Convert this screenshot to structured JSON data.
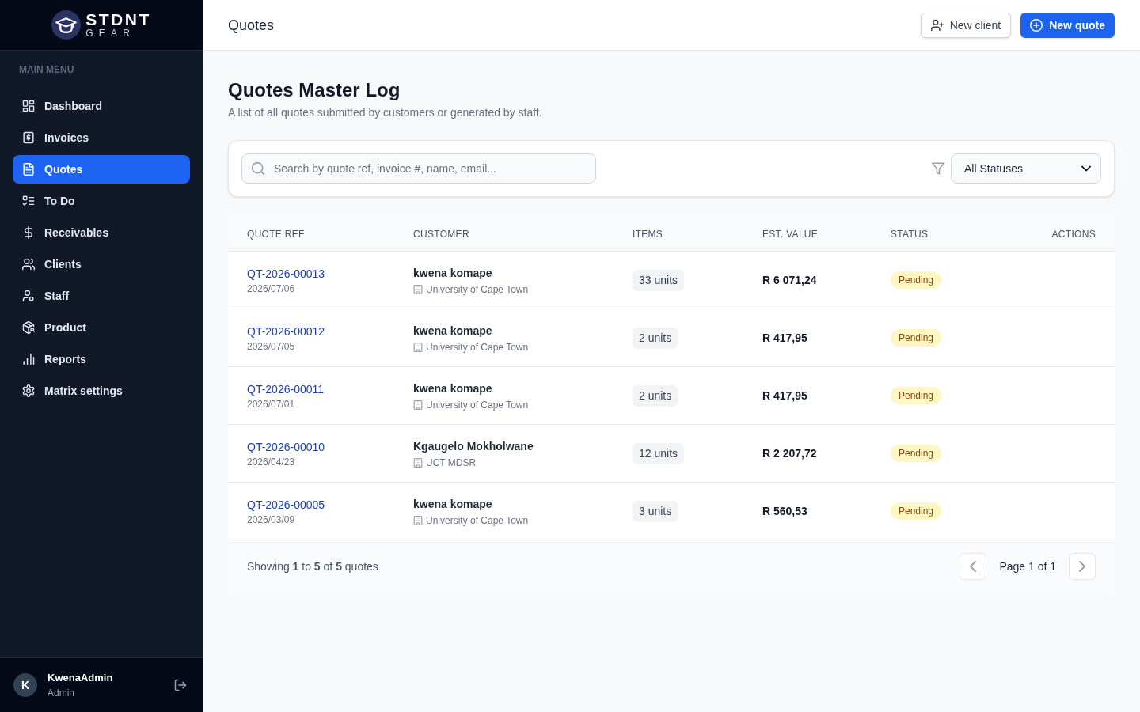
{
  "sidebar": {
    "brand": {
      "name": "STDNT",
      "tagline": "GEAR"
    },
    "section_label": "MAIN MENU",
    "items": [
      {
        "label": "Dashboard",
        "selected": false
      },
      {
        "label": "Invoices",
        "selected": false
      },
      {
        "label": "Quotes",
        "selected": true
      },
      {
        "label": "To Do",
        "selected": false
      },
      {
        "label": "Receivables",
        "selected": false
      },
      {
        "label": "Clients",
        "selected": false
      },
      {
        "label": "Staff",
        "selected": false
      },
      {
        "label": "Product",
        "selected": false
      },
      {
        "label": "Reports",
        "selected": false
      },
      {
        "label": "Matrix settings",
        "selected": false
      }
    ],
    "user": {
      "initial": "K",
      "name": "KwenaAdmin",
      "role": "Admin"
    }
  },
  "header": {
    "title": "Quotes",
    "buttons": [
      {
        "label": "New client",
        "kind": "secondary"
      },
      {
        "label": "New quote",
        "kind": "primary"
      }
    ]
  },
  "page": {
    "title": "Quotes Master Log",
    "subtitle": "A list of all quotes submitted by customers or generated by staff."
  },
  "filters": {
    "search": {
      "placeholder": "Search by quote ref, invoice #, name, email..."
    },
    "status_select": {
      "value": "All Statuses"
    }
  },
  "table": {
    "columns": [
      "QUOTE REF",
      "CUSTOMER",
      "ITEMS",
      "EST. VALUE",
      "STATUS",
      "ACTIONS"
    ],
    "rows": [
      {
        "ref": "QT-2026-00013",
        "date": "2026/07/06",
        "customer": "kwena komape",
        "organization": "University of Cape Town",
        "items": "33 units",
        "value": "R 6 071,24",
        "status": "Pending"
      },
      {
        "ref": "QT-2026-00012",
        "date": "2026/07/05",
        "customer": "kwena komape",
        "organization": "University of Cape Town",
        "items": "2 units",
        "value": "R 417,95",
        "status": "Pending"
      },
      {
        "ref": "QT-2026-00011",
        "date": "2026/07/01",
        "customer": "kwena komape",
        "organization": "University of Cape Town",
        "items": "2 units",
        "value": "R 417,95",
        "status": "Pending"
      },
      {
        "ref": "QT-2026-00010",
        "date": "2026/04/23",
        "customer": "Kgaugelo Mokholwane",
        "organization": "UCT MDSR",
        "items": "12 units",
        "value": "R 2 207,72",
        "status": "Pending"
      },
      {
        "ref": "QT-2026-00005",
        "date": "2026/03/09",
        "customer": "kwena komape",
        "organization": "University of Cape Town",
        "items": "3 units",
        "value": "R 560,53",
        "status": "Pending"
      }
    ]
  },
  "footer": {
    "summary": "Showing **1** to **5** of **5** quotes",
    "page_label": "Page 1 of 1"
  }
}
